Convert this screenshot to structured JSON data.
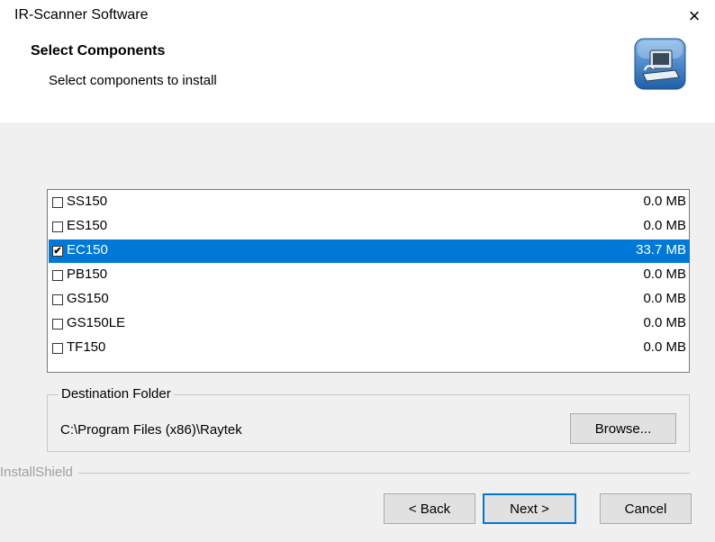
{
  "window": {
    "title": "IR-Scanner Software",
    "close_glyph": "×"
  },
  "header": {
    "title": "Select Components",
    "subtitle": "Select components to install",
    "icon": "computer-setup-icon"
  },
  "components": [
    {
      "name": "SS150",
      "size": "0.0 MB",
      "checked": false,
      "selected": false
    },
    {
      "name": "ES150",
      "size": "0.0 MB",
      "checked": false,
      "selected": false
    },
    {
      "name": "EC150",
      "size": "33.7 MB",
      "checked": true,
      "selected": true
    },
    {
      "name": "PB150",
      "size": "0.0 MB",
      "checked": false,
      "selected": false
    },
    {
      "name": "GS150",
      "size": "0.0 MB",
      "checked": false,
      "selected": false
    },
    {
      "name": "GS150LE",
      "size": "0.0 MB",
      "checked": false,
      "selected": false
    },
    {
      "name": "TF150",
      "size": "0.0 MB",
      "checked": false,
      "selected": false
    }
  ],
  "destination": {
    "legend": "Destination Folder",
    "path": "C:\\Program Files (x86)\\Raytek",
    "browse_label": "Browse..."
  },
  "footer": {
    "brand": "InstallShield",
    "back_label": "< Back",
    "next_label": "Next >",
    "cancel_label": "Cancel"
  },
  "colors": {
    "selection": "#0078d7",
    "body_bg": "#f0f0f0"
  }
}
